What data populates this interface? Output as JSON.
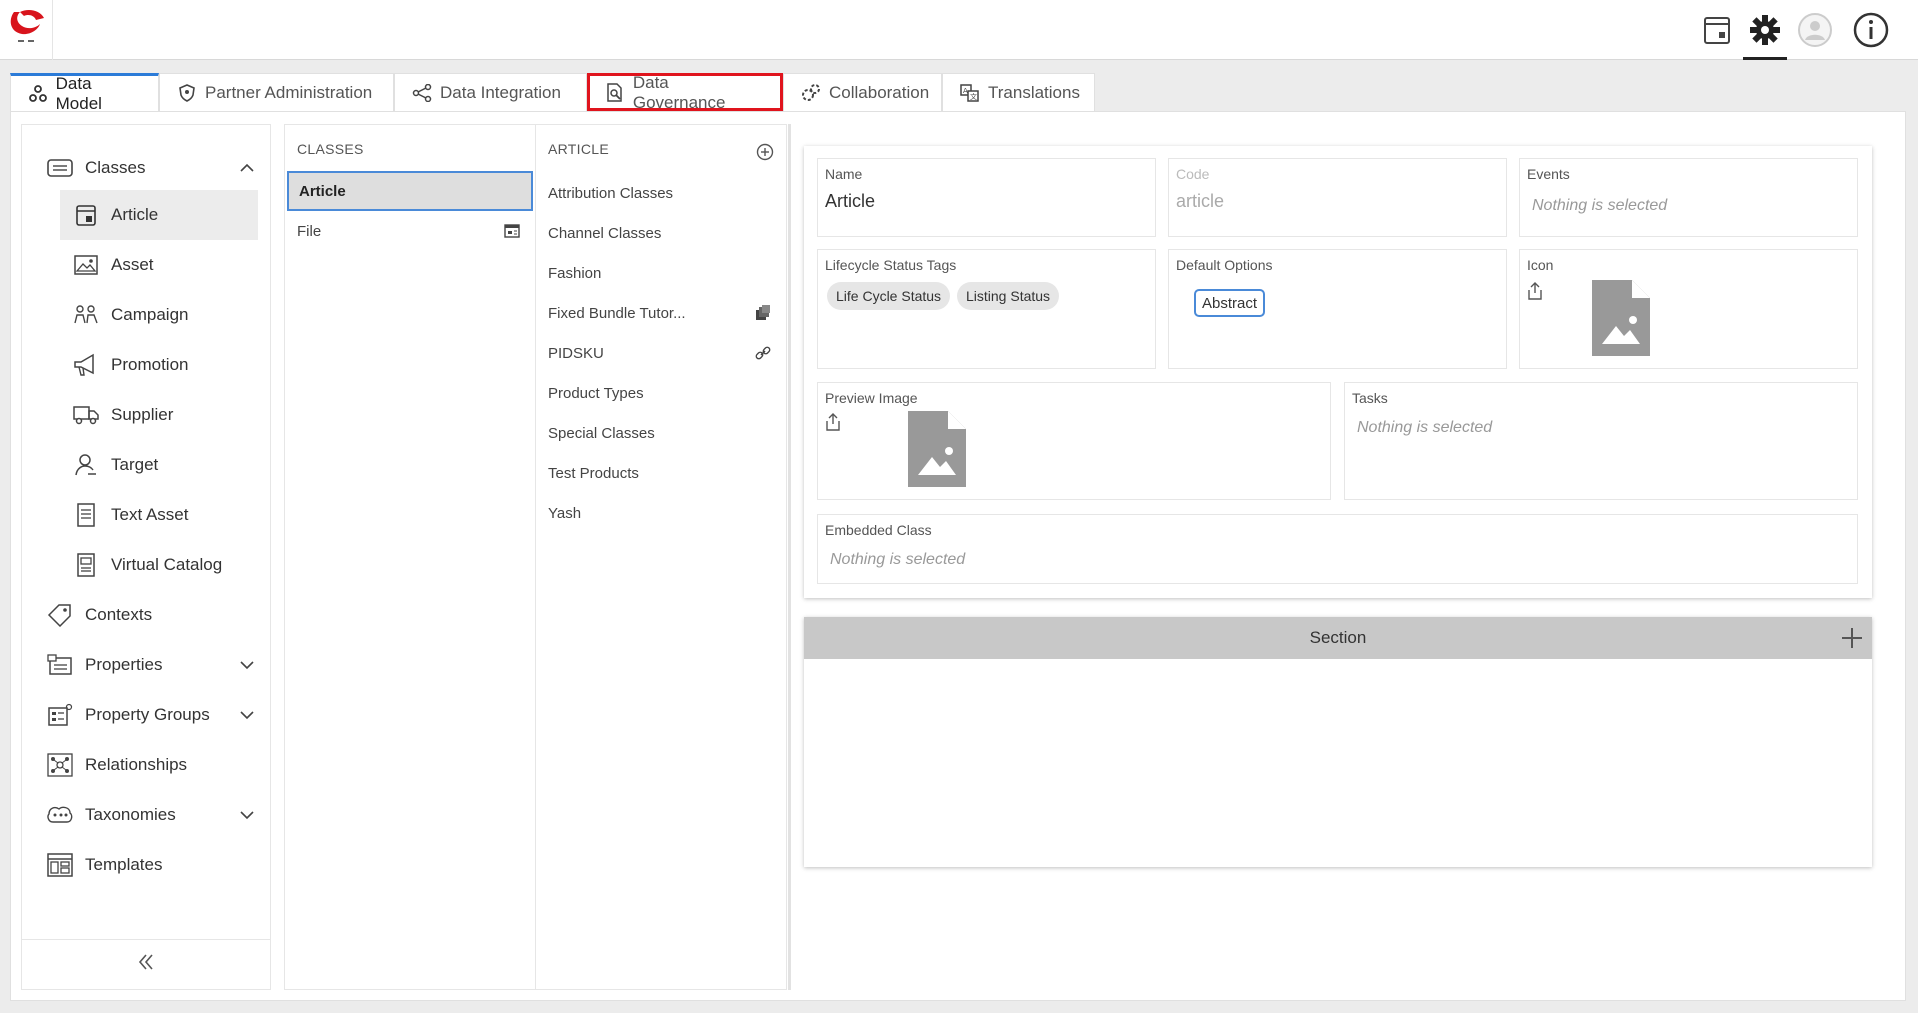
{
  "topbar": {
    "icons": [
      "calendar-icon",
      "gear-icon",
      "user-avatar-icon",
      "info-icon"
    ]
  },
  "tabs": [
    {
      "label": "Data Model",
      "icon": "data-model-icon",
      "active": true
    },
    {
      "label": "Partner Administration",
      "icon": "shield-icon",
      "active": false
    },
    {
      "label": "Data Integration",
      "icon": "integration-icon",
      "active": false
    },
    {
      "label": "Data Governance",
      "icon": "governance-icon",
      "active": false,
      "highlighted": true
    },
    {
      "label": "Collaboration",
      "icon": "gears-icon",
      "active": false
    },
    {
      "label": "Translations",
      "icon": "translate-icon",
      "active": false
    }
  ],
  "sidebar": {
    "classes": "Classes",
    "sub_items": [
      "Article",
      "Asset",
      "Campaign",
      "Promotion",
      "Supplier",
      "Target",
      "Text Asset",
      "Virtual Catalog"
    ],
    "items": [
      "Contexts",
      "Properties",
      "Property Groups",
      "Relationships",
      "Taxonomies",
      "Templates"
    ]
  },
  "classes_column": {
    "header": "CLASSES",
    "rows": [
      "Article",
      "File"
    ]
  },
  "article_column": {
    "header": "ARTICLE",
    "rows": [
      "Attribution Classes",
      "Channel Classes",
      "Fashion",
      "Fixed Bundle Tutor...",
      "PIDSKU",
      "Product Types",
      "Special Classes",
      "Test Products",
      "Yash"
    ]
  },
  "detail": {
    "name_label": "Name",
    "name_value": "Article",
    "code_label": "Code",
    "code_value": "article",
    "events_label": "Events",
    "events_empty": "Nothing is selected",
    "lifecycle_label": "Lifecycle Status Tags",
    "lifecycle_tags": [
      "Life Cycle Status",
      "Listing Status"
    ],
    "default_options_label": "Default Options",
    "default_option": "Abstract",
    "icon_label": "Icon",
    "preview_label": "Preview Image",
    "tasks_label": "Tasks",
    "tasks_empty": "Nothing is selected",
    "embedded_label": "Embedded Class",
    "embedded_empty": "Nothing is selected"
  },
  "section": {
    "title": "Section"
  },
  "colors": {
    "accent": "#2b7bd8",
    "highlight": "#e0141d",
    "selected_bg": "#dedede"
  }
}
